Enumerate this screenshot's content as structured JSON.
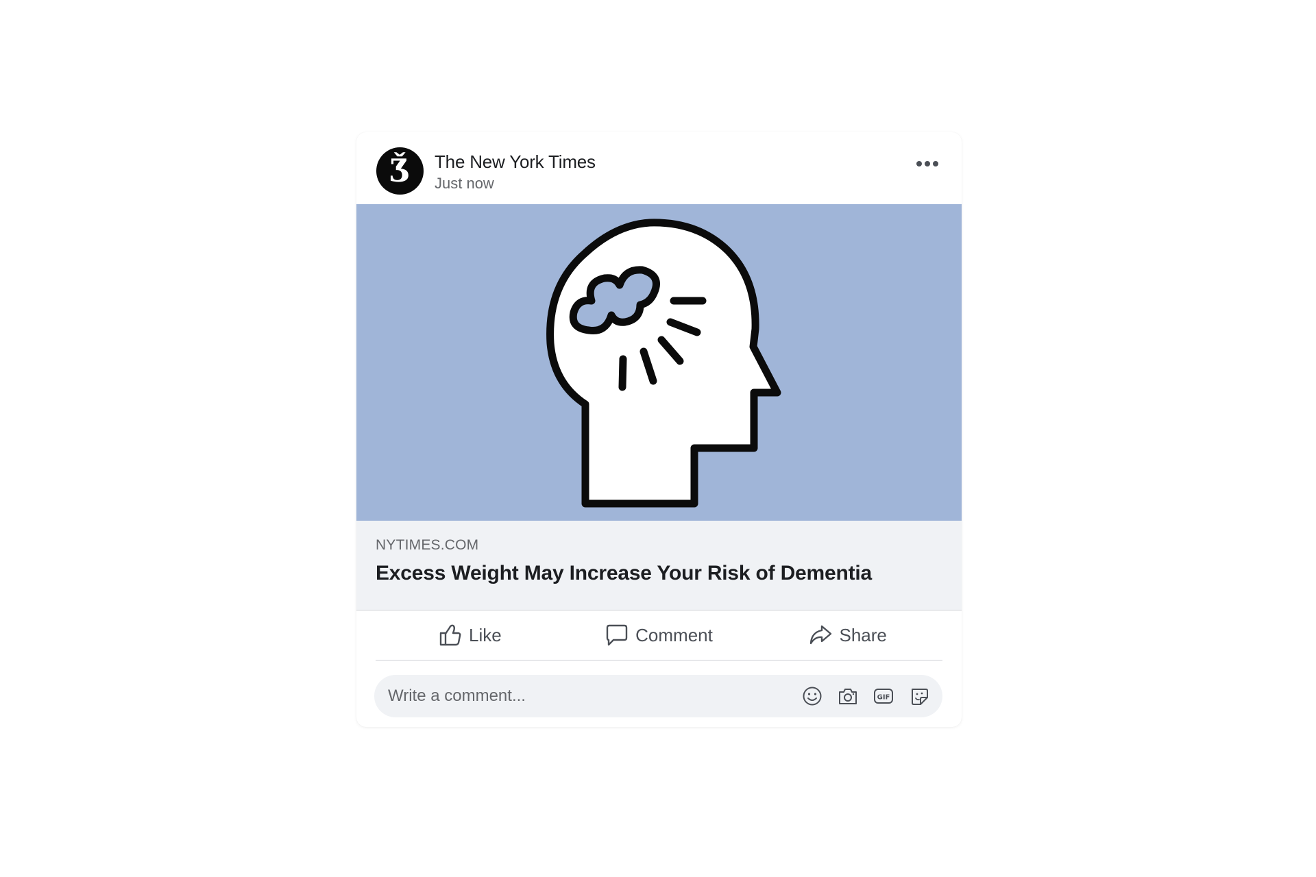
{
  "post": {
    "author": "The New York Times",
    "timestamp": "Just now",
    "avatar_glyph": "Ǯ"
  },
  "link": {
    "domain": "NYTIMES.COM",
    "title": "Excess Weight May Increase Your Risk of Dementia"
  },
  "actions": {
    "like": "Like",
    "comment": "Comment",
    "share": "Share"
  },
  "comment_box": {
    "placeholder": "Write a comment..."
  },
  "icons": {
    "more": "more-horizontal-icon",
    "like": "thumbs-up-icon",
    "comment": "speech-bubble-icon",
    "share": "share-arrow-icon",
    "emoji": "smiley-icon",
    "camera": "camera-icon",
    "gif": "gif-icon",
    "sticker": "sticker-icon",
    "hero": "head-brain-illustration"
  },
  "colors": {
    "hero_background": "#a0b5d8",
    "preview_background": "#f0f2f5",
    "text_primary": "#1c1e21",
    "text_secondary": "#65676b"
  }
}
